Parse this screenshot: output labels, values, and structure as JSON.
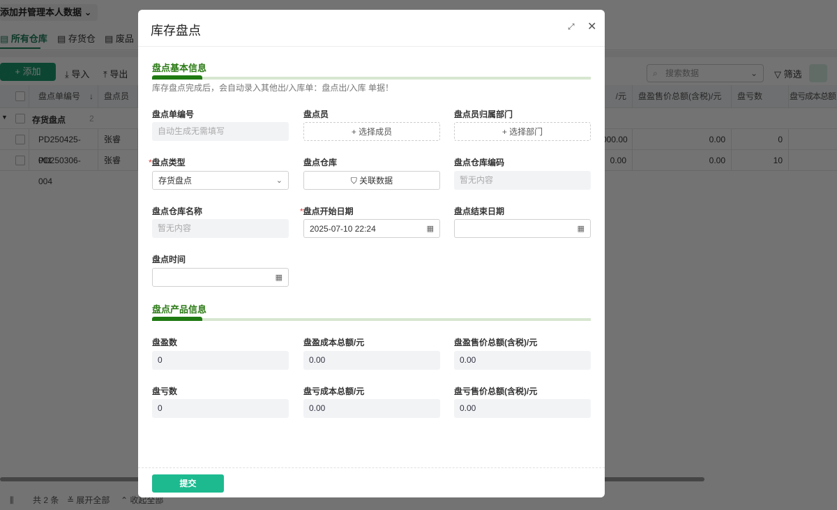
{
  "background": {
    "scope_label": "添加并管理本人数据",
    "tabs": [
      "所有仓库",
      "存货仓",
      "废品"
    ],
    "toolbar": {
      "add": "+ 添加",
      "import": "导入",
      "export": "导出",
      "search_placeholder": "搜索数据",
      "filter": "筛选"
    },
    "table": {
      "headers": {
        "code": "盘点单编号",
        "operator": "盘点员",
        "col_partial": "/元",
        "profit_sale": "盘盈售价总额(含税)/元",
        "loss_count": "盘亏数",
        "loss_cost": "盘亏成本总额"
      },
      "group": {
        "label": "存货盘点",
        "count": "2"
      },
      "rows": [
        {
          "code": "PD250425-001",
          "operator": "张睿",
          "partial": "000.00",
          "profit_sale": "0.00",
          "loss_count": "0"
        },
        {
          "code": "PD250306-004",
          "operator": "张睿",
          "partial": "0.00",
          "profit_sale": "0.00",
          "loss_count": "10"
        }
      ]
    },
    "footer": {
      "total": "共 2 条",
      "expand": "展开全部",
      "collapse": "收起全部"
    }
  },
  "modal": {
    "title": "库存盘点",
    "basic": {
      "title": "盘点基本信息",
      "note": "库存盘点完成后，会自动录入其他出/入库单：盘点出/入库 单据！",
      "code_label": "盘点单编号",
      "code_placeholder": "自动生成无需填写",
      "operator_label": "盘点员",
      "operator_btn": "+ 选择成员",
      "dept_label": "盘点员归属部门",
      "dept_btn": "+ 选择部门",
      "type_label": "盘点类型",
      "type_value": "存货盘点",
      "wh_label": "盘点仓库",
      "wh_btn": "关联数据",
      "wh_code_label": "盘点仓库编码",
      "wh_code_value": "暂无内容",
      "wh_name_label": "盘点仓库名称",
      "wh_name_value": "暂无内容",
      "start_label": "盘点开始日期",
      "start_value": "2025-07-10 22:24",
      "end_label": "盘点结束日期",
      "end_value": "",
      "time_label": "盘点时间",
      "time_value": "",
      "required": "*"
    },
    "product": {
      "title": "盘点产品信息",
      "fields": [
        {
          "label": "盘盈数",
          "value": "0"
        },
        {
          "label": "盘盈成本总额/元",
          "value": "0.00"
        },
        {
          "label": "盘盈售价总额(含税)/元",
          "value": "0.00"
        },
        {
          "label": "盘亏数",
          "value": "0"
        },
        {
          "label": "盘亏成本总额/元",
          "value": "0.00"
        },
        {
          "label": "盘亏售价总额(含税)/元",
          "value": "0.00"
        }
      ]
    },
    "submit": "提交"
  }
}
